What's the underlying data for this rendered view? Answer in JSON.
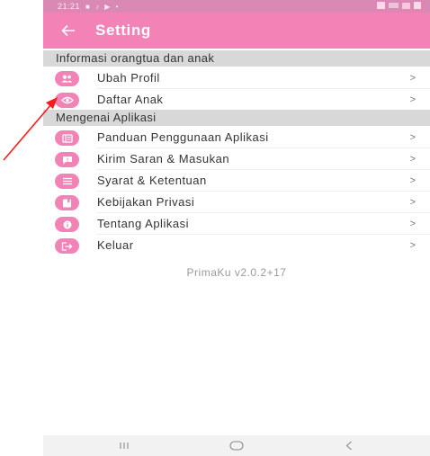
{
  "status_bar": {
    "time": "21:21",
    "icons": "■ ♪ ▶ •"
  },
  "app_bar": {
    "title": "Setting",
    "back_icon": "arrow-left-icon"
  },
  "sections": [
    {
      "header": "Informasi orangtua dan anak",
      "items": [
        {
          "label": "Ubah Profil",
          "icon": "users-icon"
        },
        {
          "label": "Daftar Anak",
          "icon": "eye-icon"
        }
      ]
    },
    {
      "header": "Mengenai Aplikasi",
      "items": [
        {
          "label": "Panduan Penggunaan Aplikasi",
          "icon": "book-icon"
        },
        {
          "label": "Kirim Saran & Masukan",
          "icon": "feedback-icon"
        },
        {
          "label": "Syarat & Ketentuan",
          "icon": "list-icon"
        },
        {
          "label": "Kebijakan Privasi",
          "icon": "bookmark-icon"
        },
        {
          "label": "Tentang Aplikasi",
          "icon": "info-icon"
        },
        {
          "label": "Keluar",
          "icon": "logout-icon"
        }
      ]
    }
  ],
  "chevron": ">",
  "version": "PrimaKu v2.0.2+17",
  "nav_bar": {
    "recents": "III",
    "home": "○",
    "back": "<"
  },
  "colors": {
    "accent": "#f383b7",
    "status_bar": "#d989b4",
    "annotation": "#ff1a1a"
  }
}
